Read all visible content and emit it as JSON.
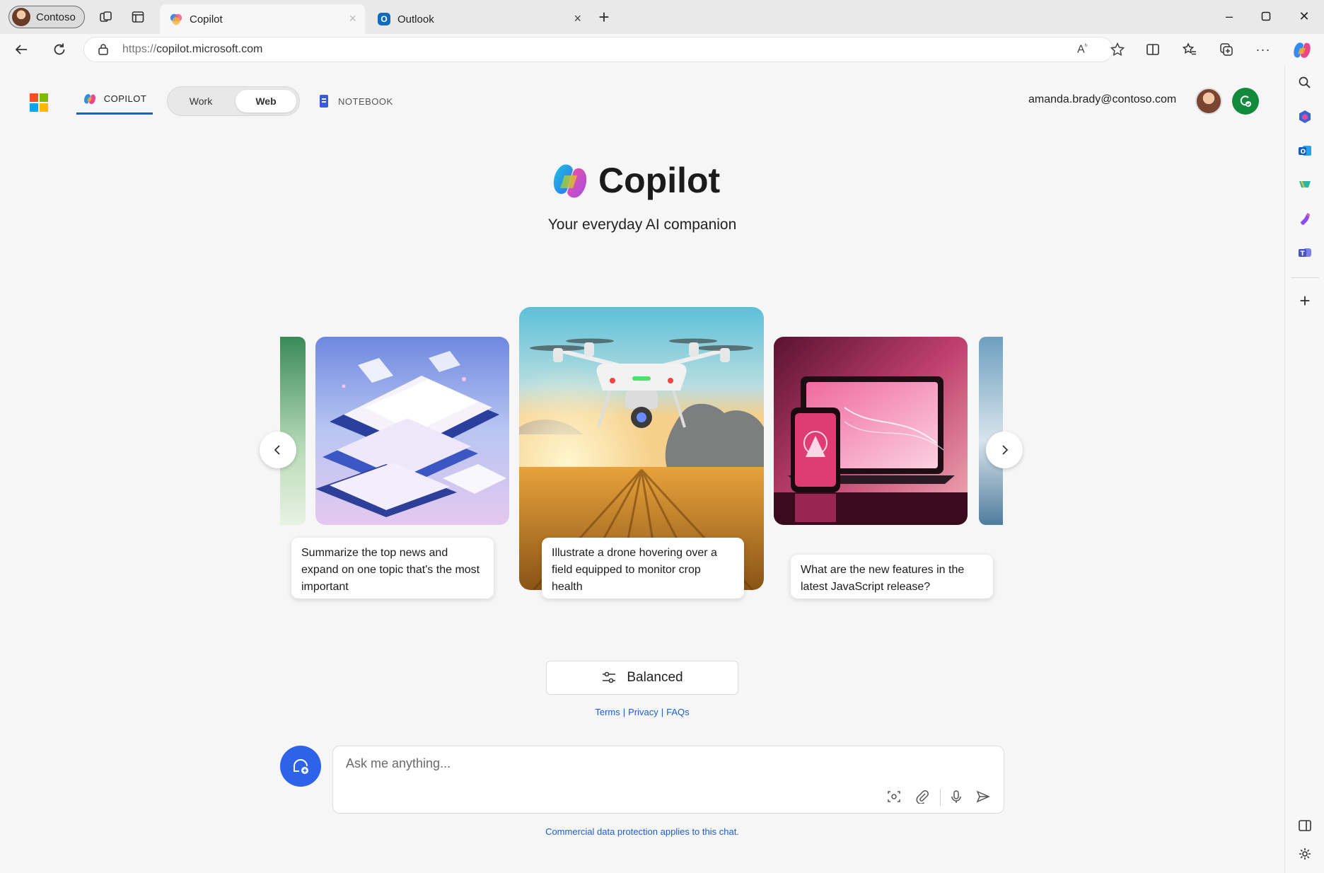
{
  "browser": {
    "profile_label": "Contoso",
    "tabs": [
      {
        "label": "Copilot",
        "active": true
      },
      {
        "label": "Outlook",
        "active": false
      }
    ],
    "address": {
      "protocol": "https://",
      "host": "copilot.microsoft.com"
    }
  },
  "nav": {
    "copilot_label": "COPILOT",
    "toggle": {
      "work": "Work",
      "web": "Web",
      "selected": "Web"
    },
    "notebook_label": "NOTEBOOK",
    "user_email": "amanda.brady@contoso.com"
  },
  "hero": {
    "title": "Copilot",
    "subtitle": "Your everyday AI companion"
  },
  "carousel": {
    "cards": [
      {
        "caption": "Summarize the top news and expand on one topic that's the most important",
        "image": "abstract-documents"
      },
      {
        "caption": "Illustrate a drone hovering over a field equipped to monitor crop health",
        "image": "drone-over-wheat-field"
      },
      {
        "caption": "What are the new features in the latest JavaScript release?",
        "image": "laptop-and-phone-pink"
      }
    ]
  },
  "mode": {
    "label": "Balanced"
  },
  "footer_links": {
    "terms": "Terms",
    "privacy": "Privacy",
    "faqs": "FAQs",
    "separator": "|"
  },
  "composer": {
    "placeholder": "Ask me anything...",
    "notice": "Commercial data protection applies to this chat."
  },
  "colors": {
    "accent": "#1a5ed4",
    "new_chat": "#2c63e8",
    "green_badge": "#128a3c"
  }
}
